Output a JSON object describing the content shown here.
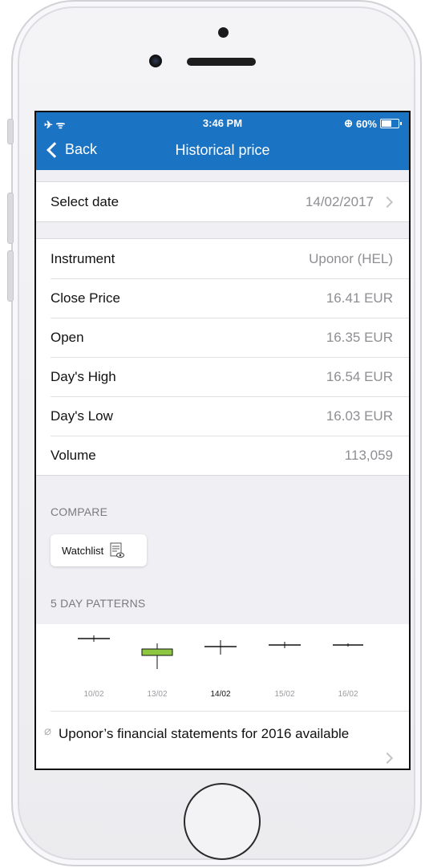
{
  "status_bar": {
    "time": "3:46 PM",
    "left_icons": "✈ ᯤ",
    "battery_text": "60%",
    "rotation_lock": "⊕"
  },
  "nav": {
    "back_label": "Back",
    "title": "Historical price"
  },
  "date_row": {
    "label": "Select date",
    "value": "14/02/2017"
  },
  "details": [
    {
      "label": "Instrument",
      "value": "Uponor (HEL)"
    },
    {
      "label": "Close Price",
      "value": "16.41 EUR"
    },
    {
      "label": "Open",
      "value": "16.35 EUR"
    },
    {
      "label": "Day's High",
      "value": "16.54 EUR"
    },
    {
      "label": "Day's Low",
      "value": "16.03 EUR"
    },
    {
      "label": "Volume",
      "value": "113,059"
    }
  ],
  "compare": {
    "header": "COMPARE",
    "watchlist_label": "Watchlist"
  },
  "patterns": {
    "header": "5 DAY PATTERNS",
    "days": [
      {
        "date": "10/02",
        "type": "flat"
      },
      {
        "date": "13/02",
        "type": "green-body"
      },
      {
        "date": "14/02",
        "type": "doji",
        "active": true
      },
      {
        "date": "15/02",
        "type": "flat"
      },
      {
        "date": "16/02",
        "type": "flat"
      }
    ]
  },
  "news": {
    "text": "Uponor’s financial statements for 2016 available"
  },
  "colors": {
    "nav_blue": "#1b73c4",
    "candle_green": "#8dc63f"
  }
}
